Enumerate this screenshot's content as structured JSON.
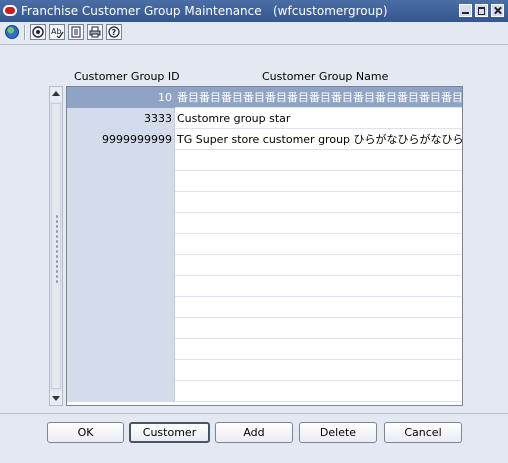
{
  "window": {
    "title": "Franchise Customer Group Maintenance",
    "code": "(wfcustomergroup)"
  },
  "toolbar": {
    "icons": [
      "globe-icon",
      "help-icon",
      "spellcheck-icon",
      "notes-icon",
      "print-icon",
      "help-question-icon"
    ]
  },
  "grid": {
    "headers": {
      "id": "Customer Group ID",
      "name": "Customer Group Name"
    },
    "rows": [
      {
        "id": "10",
        "name": "番目番目番目番目番目番目番目番目番目番目番目番目番目番目"
      },
      {
        "id": "3333",
        "name": "Customre group star"
      },
      {
        "id": "9999999999",
        "name": "TG Super store customer group ひらがなひらがなひらがなひらがな"
      },
      {
        "id": "",
        "name": ""
      },
      {
        "id": "",
        "name": ""
      },
      {
        "id": "",
        "name": ""
      },
      {
        "id": "",
        "name": ""
      },
      {
        "id": "",
        "name": ""
      },
      {
        "id": "",
        "name": ""
      },
      {
        "id": "",
        "name": ""
      },
      {
        "id": "",
        "name": ""
      },
      {
        "id": "",
        "name": ""
      },
      {
        "id": "",
        "name": ""
      },
      {
        "id": "",
        "name": ""
      },
      {
        "id": "",
        "name": ""
      }
    ],
    "selected_row": 0
  },
  "buttons": {
    "ok": "OK",
    "customer": "Customer",
    "add": "Add",
    "delete": "Delete",
    "cancel": "Cancel"
  },
  "colors": {
    "window_bg": "#e4e9f1",
    "titlebar": "#3b5f97",
    "selected_row": "#8fa3c4",
    "id_column": "#d3dcea"
  }
}
